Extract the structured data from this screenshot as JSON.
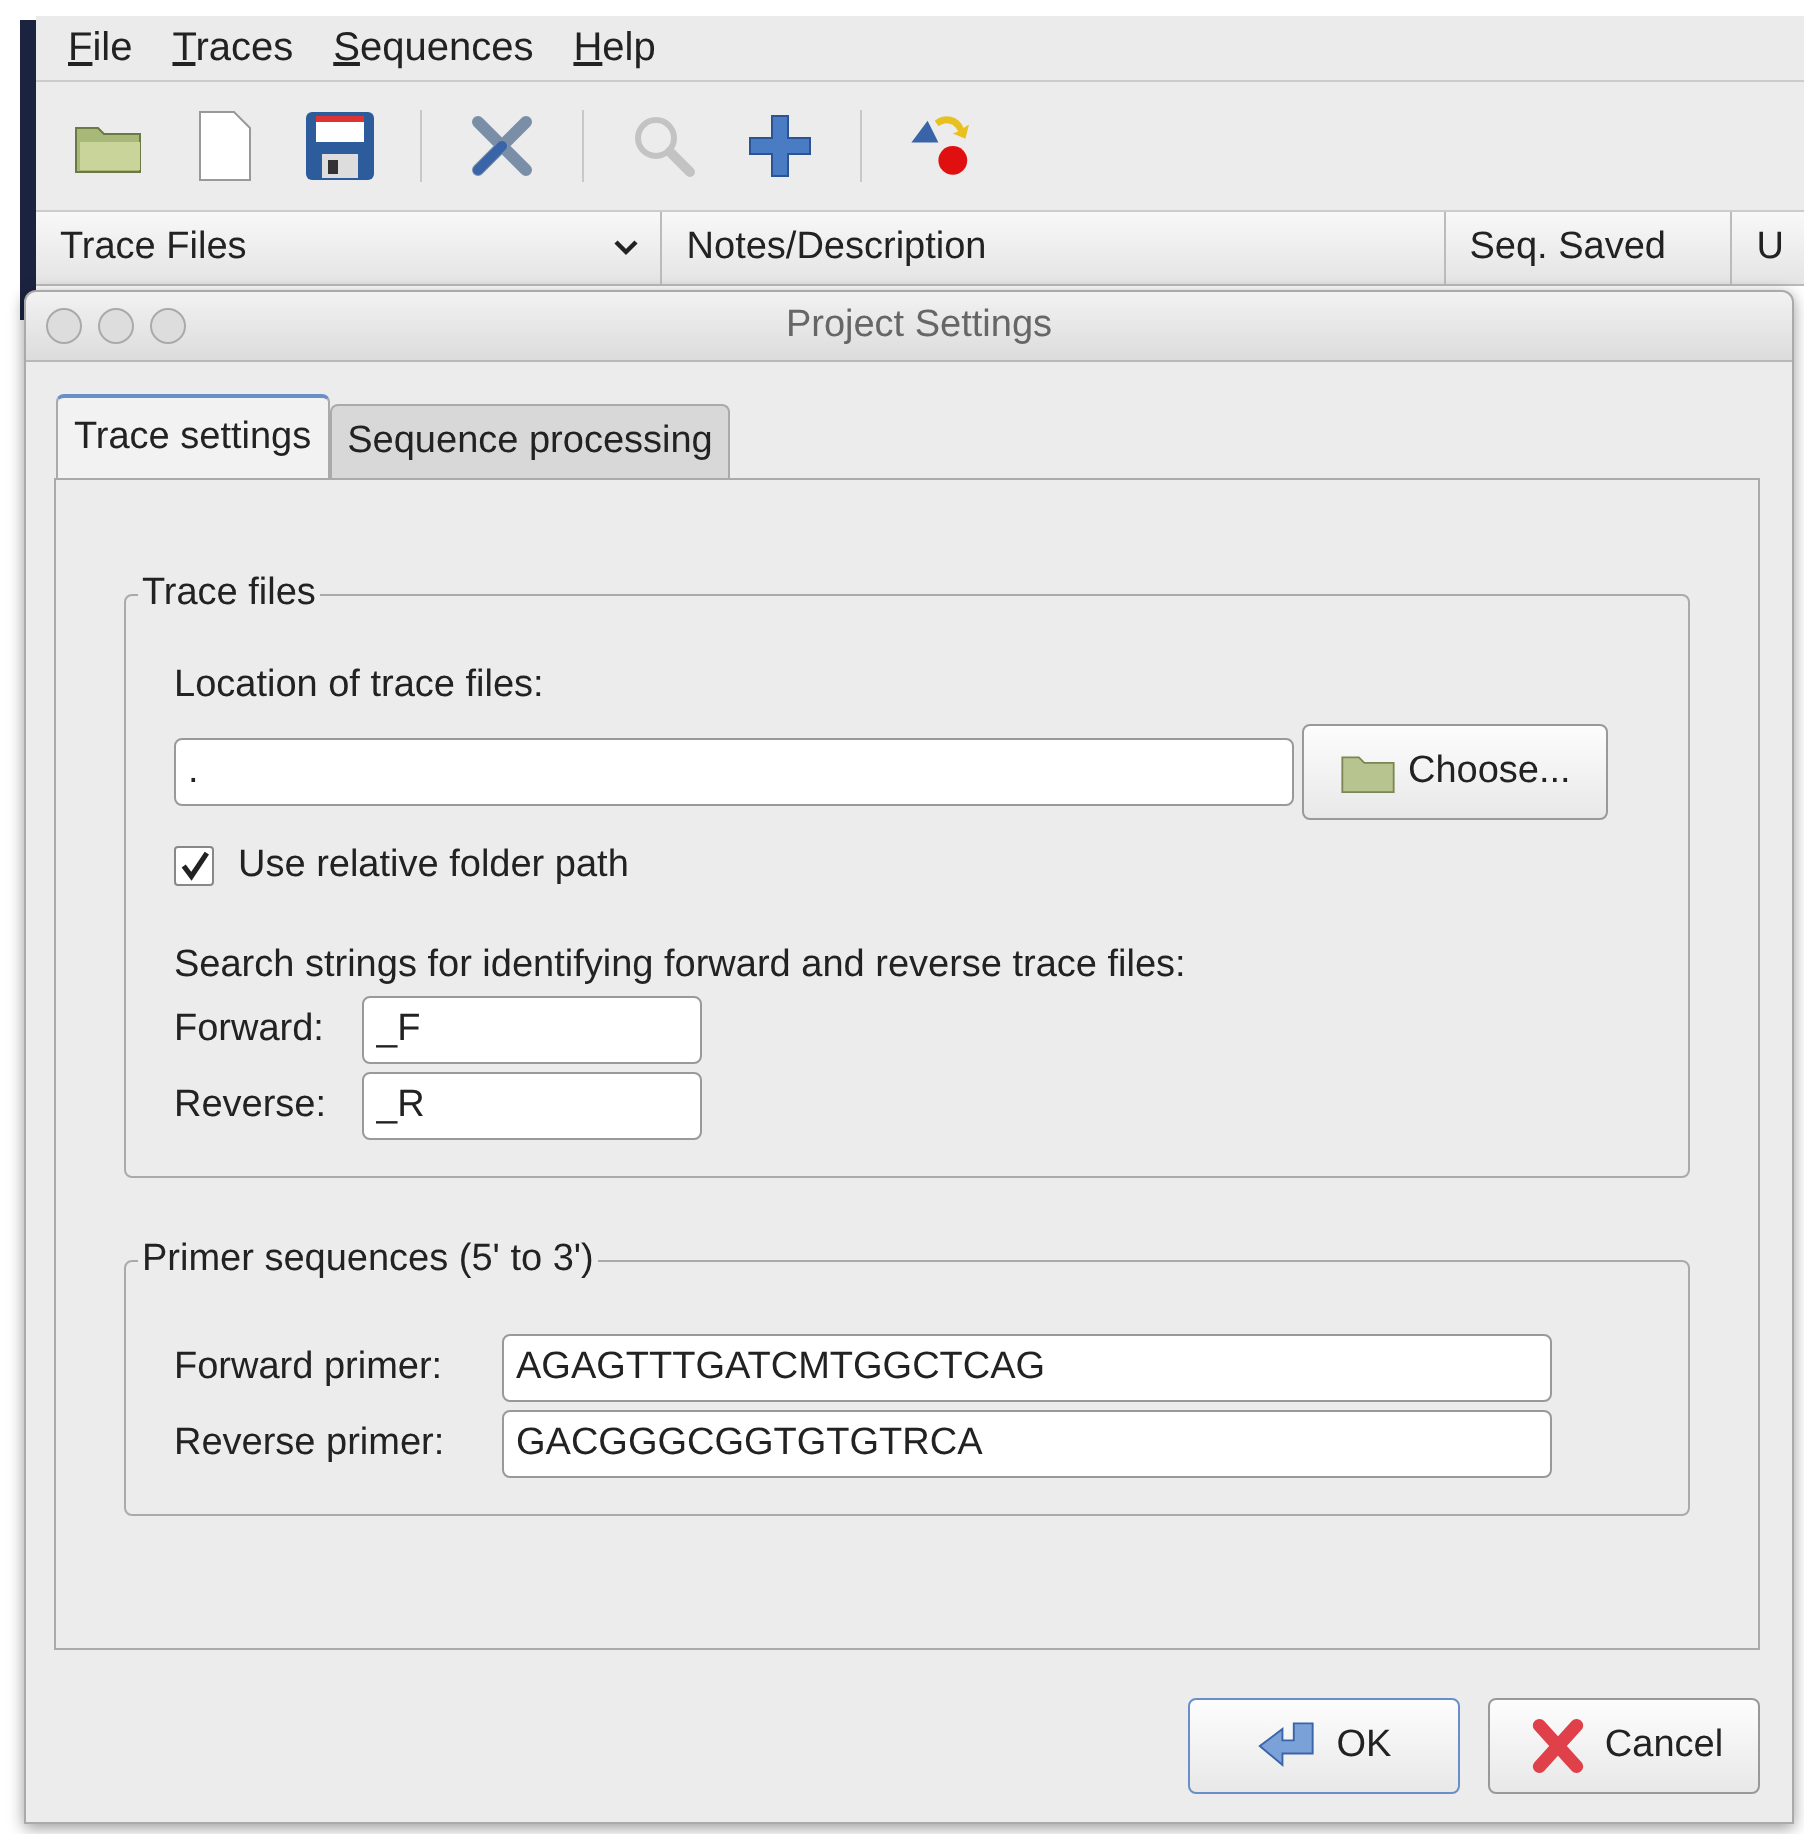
{
  "menu": [
    "File",
    "Traces",
    "Sequences",
    "Help"
  ],
  "toolbar": [
    {
      "kind": "open"
    },
    {
      "kind": "new"
    },
    {
      "kind": "save"
    },
    {
      "kind": "sep"
    },
    {
      "kind": "tools"
    },
    {
      "kind": "sep"
    },
    {
      "kind": "search",
      "disabled": true
    },
    {
      "kind": "add"
    },
    {
      "kind": "sep"
    },
    {
      "kind": "run"
    }
  ],
  "columns": [
    {
      "label": "Trace Files",
      "sorted": true
    },
    {
      "label": "Notes/Description",
      "sorted": false
    },
    {
      "label": "Seq. Saved",
      "sorted": false
    },
    {
      "label": "U",
      "sorted": false
    }
  ],
  "dialog": {
    "title": "Project Settings",
    "tabs": [
      {
        "label": "Trace settings",
        "selected": true
      },
      {
        "label": "Sequence processing",
        "selected": false
      }
    ],
    "trace_files": {
      "title": "Trace files",
      "location_label": "Location of trace files:",
      "location_value": ".",
      "choose_button": "Choose...",
      "relative": {
        "label": "Use relative folder path",
        "checked": true
      },
      "search_label": "Search strings for identifying forward and reverse trace files:",
      "forward_label": "Forward:",
      "forward_value": "_F",
      "reverse_label": "Reverse:",
      "reverse_value": "_R"
    },
    "primers": {
      "title": "Primer sequences (5' to 3')",
      "forward_label": "Forward primer:",
      "forward_value": "AGAGTTTGATCMTGGCTCAG",
      "reverse_label": "Reverse primer:",
      "reverse_value": "GACGGGCGGTGTGTRCA"
    },
    "buttons": [
      {
        "kind": "ok",
        "label": "OK",
        "default": true
      },
      {
        "kind": "cancel",
        "label": "Cancel",
        "default": false
      }
    ]
  }
}
